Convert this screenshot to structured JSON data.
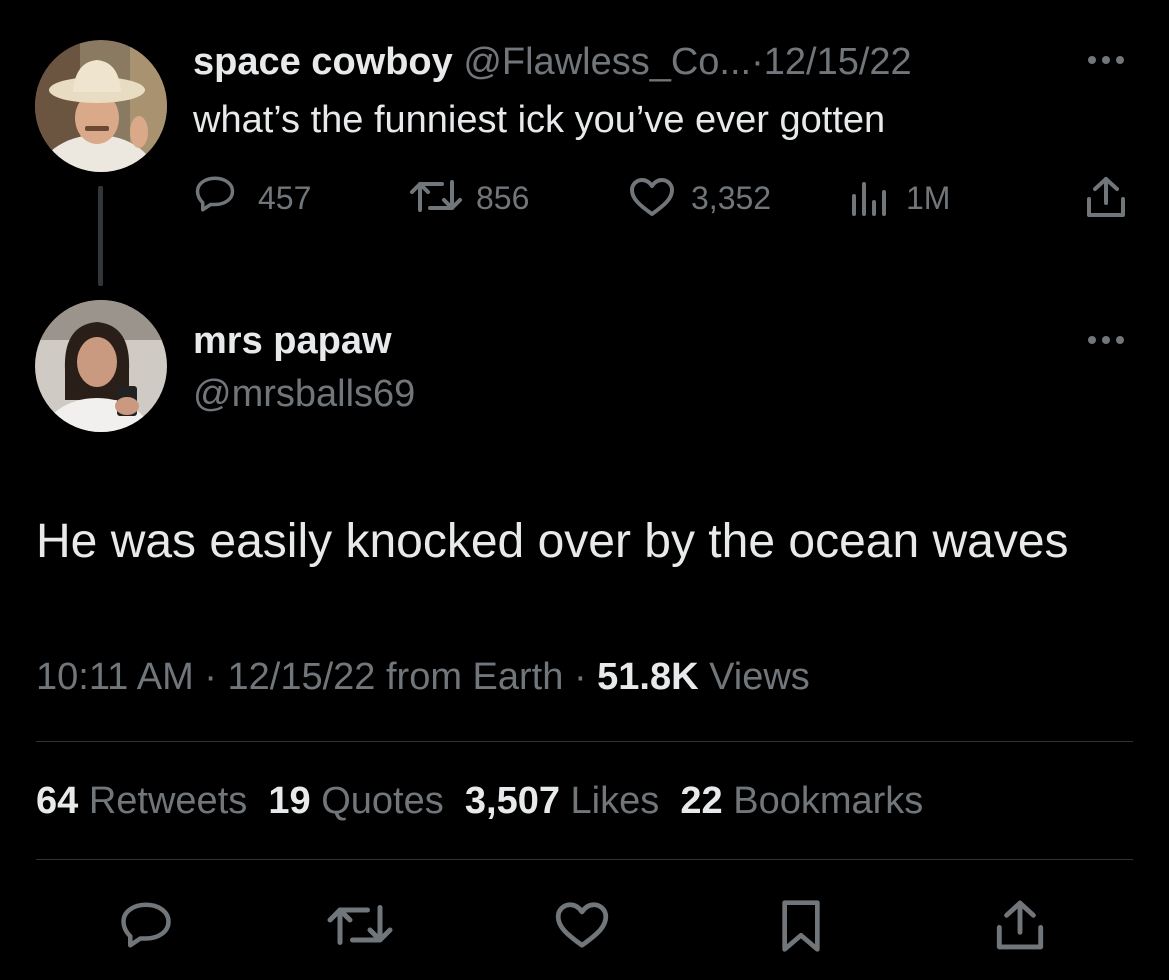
{
  "parent_tweet": {
    "display_name": "space cowboy",
    "handle": "@Flawless_Co...",
    "separator": "·",
    "date": "12/15/22",
    "text": "what’s the funniest ick you’ve ever gotten",
    "actions": {
      "replies": "457",
      "retweets": "856",
      "likes": "3,352",
      "views": "1M"
    }
  },
  "reply_tweet": {
    "display_name": "mrs papaw",
    "handle": "@mrsballs69",
    "text": "He was easily knocked over by the ocean waves",
    "time": "10:11 AM",
    "dot1": "·",
    "date_source": "12/15/22 from Earth",
    "dot2": "·",
    "views_count": "51.8K",
    "views_label": "Views"
  },
  "stats": {
    "retweets_count": "64",
    "retweets_label": "Retweets",
    "quotes_count": "19",
    "quotes_label": "Quotes",
    "likes_count": "3,507",
    "likes_label": "Likes",
    "bookmarks_count": "22",
    "bookmarks_label": "Bookmarks"
  },
  "icons": {
    "more": "more-horizontal-icon",
    "reply": "reply-icon",
    "retweet": "retweet-icon",
    "like": "heart-icon",
    "views": "views-bar-chart-icon",
    "share": "share-icon",
    "bookmark": "bookmark-icon"
  },
  "colors": {
    "background": "#000000",
    "text_primary": "#e7e9ea",
    "text_secondary": "#71767b",
    "divider": "#2f3336"
  }
}
